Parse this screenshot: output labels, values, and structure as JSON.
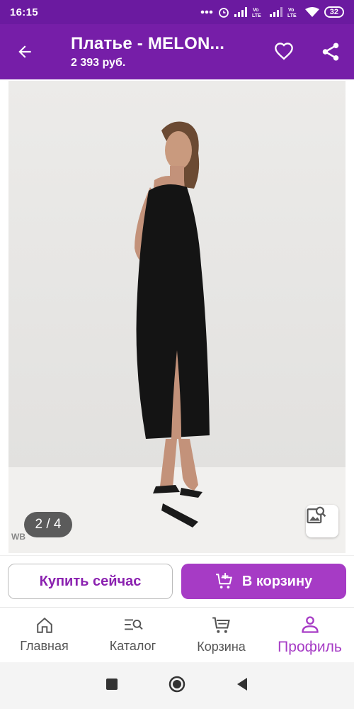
{
  "status": {
    "time": "16:15",
    "battery": "32"
  },
  "header": {
    "title": "Платье - MELON...",
    "price": "2 393 руб."
  },
  "gallery": {
    "counter": "2 / 4",
    "watermark": "WB"
  },
  "actions": {
    "buy_label": "Купить сейчас",
    "cart_label": "В корзину"
  },
  "nav": {
    "items": [
      {
        "label": "Главная",
        "icon": "home-icon"
      },
      {
        "label": "Каталог",
        "icon": "catalog-search-icon"
      },
      {
        "label": "Корзина",
        "icon": "cart-icon"
      },
      {
        "label": "Профиль",
        "icon": "profile-icon"
      }
    ]
  },
  "colors": {
    "brand": "#761ea8",
    "accent": "#a63bc5",
    "statusbar": "#6b1aa0"
  }
}
